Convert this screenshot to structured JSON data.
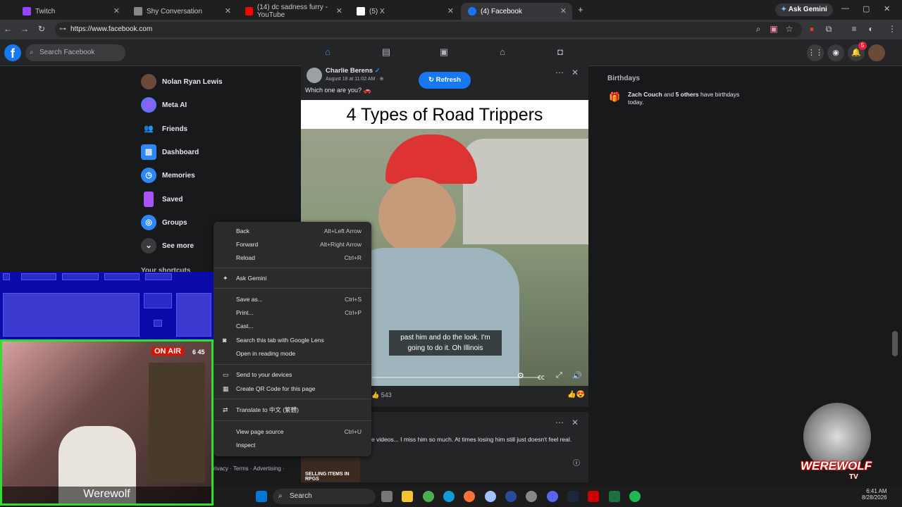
{
  "browser": {
    "tabs": [
      {
        "title": "Twitch",
        "color": "#9146ff"
      },
      {
        "title": "Shy Conversation",
        "color": "#888888"
      },
      {
        "title": "(14) dc sadness furry - YouTube",
        "color": "#ff0000"
      },
      {
        "title": "(5) X",
        "color": "#ffffff"
      },
      {
        "title": "(4) Facebook",
        "color": "#1877f2"
      }
    ],
    "new_tab": "+",
    "ask_gemini": "Ask Gemini",
    "url": "https://www.facebook.com"
  },
  "facebook": {
    "logo": "f",
    "search_placeholder": "Search Facebook",
    "notif_count": "5",
    "sidebar": [
      {
        "label": "Nolan Ryan Lewis",
        "icon": "avatar",
        "color": "#6b4a3a"
      },
      {
        "label": "Meta AI",
        "icon": "meta-ai-icon",
        "color": "#8b5cf6"
      },
      {
        "label": "Friends",
        "icon": "friends-icon",
        "color": "#2d88ff"
      },
      {
        "label": "Dashboard",
        "icon": "dashboard-icon",
        "color": "#2d88ff"
      },
      {
        "label": "Memories",
        "icon": "memories-icon",
        "color": "#2d88ff"
      },
      {
        "label": "Saved",
        "icon": "saved-icon",
        "color": "#a855f7"
      },
      {
        "label": "Groups",
        "icon": "groups-icon",
        "color": "#2d88ff"
      },
      {
        "label": "See more",
        "icon": "chevron-down-icon",
        "color": "#3a3b3c"
      }
    ],
    "shortcuts_heading": "Your shortcuts",
    "post": {
      "author": "Charlie Berens",
      "date": "August 18 at 11:02 AM · ",
      "caption": "Which one are you? 🚗",
      "refresh_label": "Refresh",
      "video_title": "4 Types of Road Trippers",
      "subtitle_line1": "past him and do the look. I'm",
      "subtitle_line2": "going to do it. Oh Illinois",
      "likes": "543"
    },
    "post2": {
      "text": "e videos... I miss him so much. At times losing him still just doesn't feel real.",
      "thumb_text": "SELLING ITEMS IN RPGS"
    },
    "footer": "rivacy · Terms · Advertising ·",
    "birthdays": {
      "heading": "Birthdays",
      "name": "Zach Couch",
      "mid": " and ",
      "others": "5 others",
      "tail": " have birthdays",
      "line2": "today."
    }
  },
  "context_menu": {
    "items": [
      {
        "label": "Back",
        "shortcut": "Alt+Left Arrow"
      },
      {
        "label": "Forward",
        "shortcut": "Alt+Right Arrow"
      },
      {
        "label": "Reload",
        "shortcut": "Ctrl+R"
      },
      {
        "label": "Ask Gemini",
        "shortcut": ""
      },
      {
        "label": "Save as...",
        "shortcut": "Ctrl+S"
      },
      {
        "label": "Print...",
        "shortcut": "Ctrl+P"
      },
      {
        "label": "Cast...",
        "shortcut": ""
      },
      {
        "label": "Search this tab with Google Lens",
        "shortcut": ""
      },
      {
        "label": "Open in reading mode",
        "shortcut": ""
      },
      {
        "label": "Send to your devices",
        "shortcut": ""
      },
      {
        "label": "Create QR Code for this page",
        "shortcut": ""
      },
      {
        "label": "Translate to 中文 (繁體)",
        "shortcut": ""
      },
      {
        "label": "View page source",
        "shortcut": "Ctrl+U"
      },
      {
        "label": "Inspect",
        "shortcut": ""
      }
    ]
  },
  "overlay": {
    "on_air": "ON AIR",
    "counter": "6 45",
    "streamer_name": "Werewolf",
    "brand": "WEREWOLF",
    "brand_sub": "TV"
  },
  "taskbar": {
    "search": "Search",
    "time": "6:41 AM",
    "date": "8/28/2026"
  }
}
